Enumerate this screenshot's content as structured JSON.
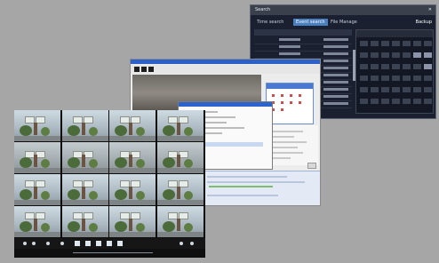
{
  "back_window": {
    "title": "Search",
    "close_glyph": "✕",
    "tabs": [
      "Time search",
      "Event search",
      "File Manage"
    ],
    "active_tab": 1,
    "backup_label": "Backup"
  },
  "middle_window": {},
  "front_window": {
    "camera_count": 16,
    "status_left": "",
    "status_mid": "",
    "status_right": ""
  },
  "colors": {
    "background": "#a6a6a6",
    "accent_blue": "#4a7fbf",
    "xp_title_blue": "#2b61c8"
  }
}
